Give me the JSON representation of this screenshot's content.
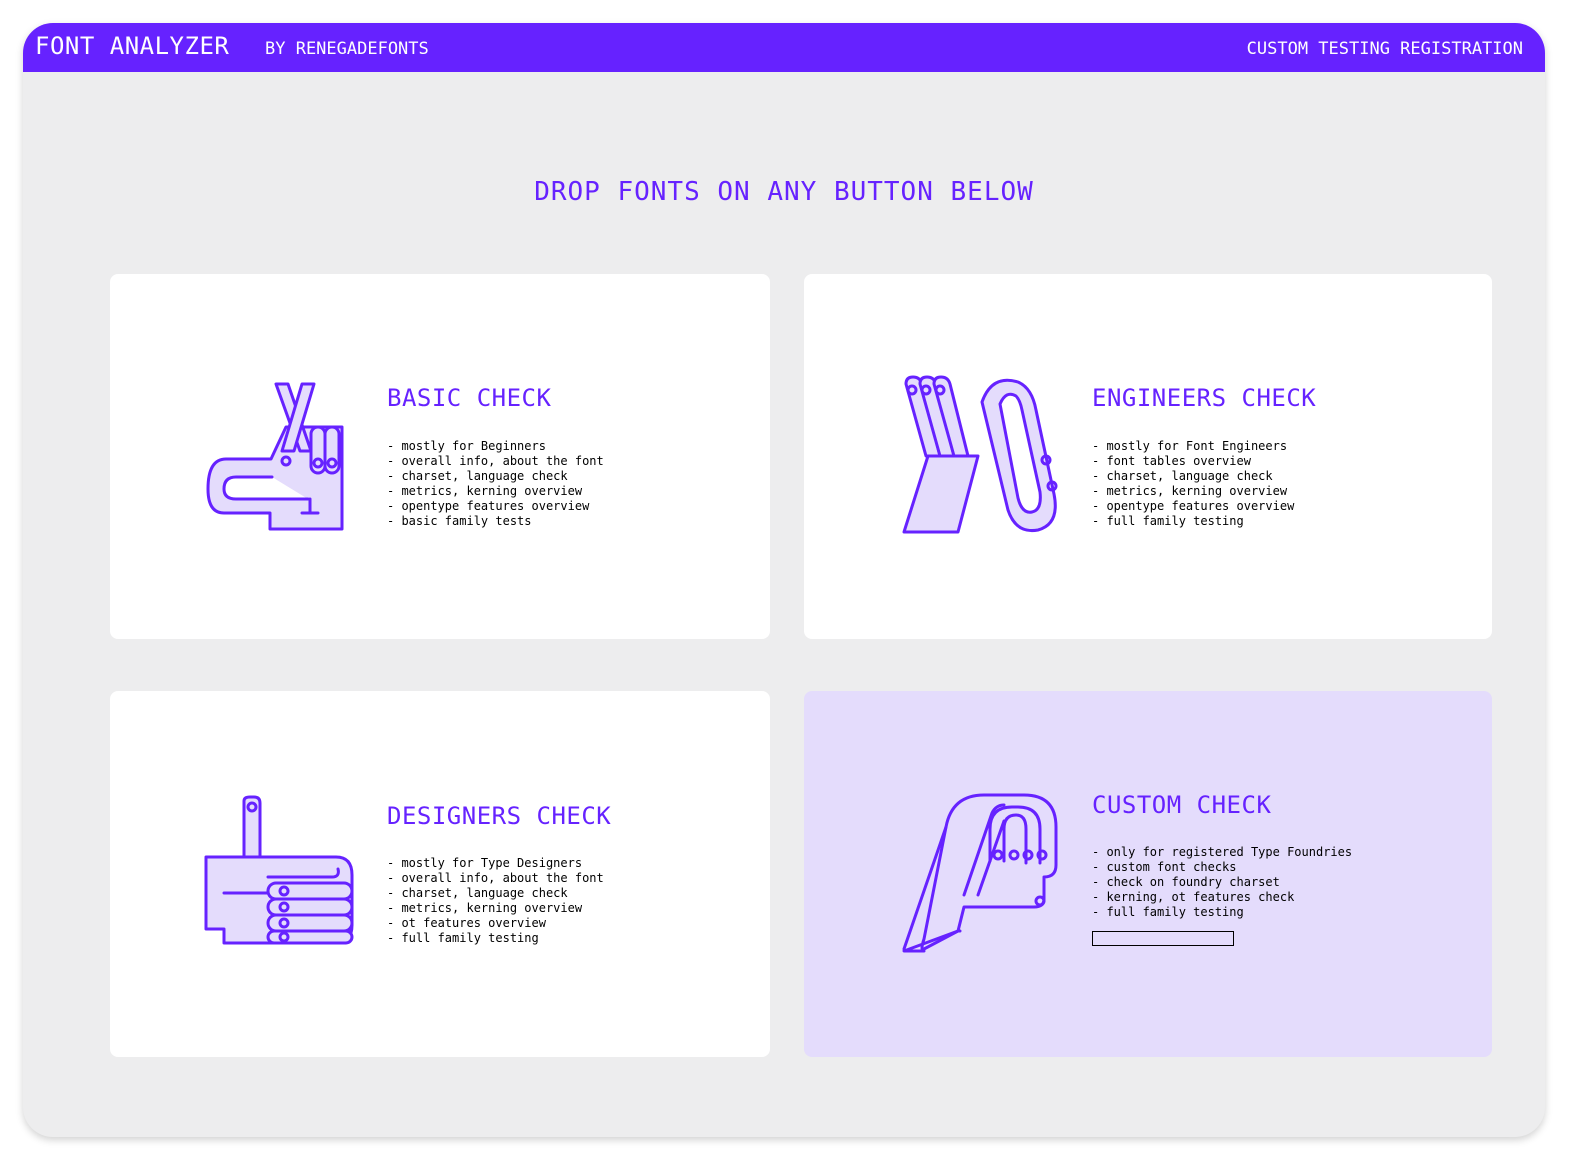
{
  "header": {
    "title": "FONT ANALYZER",
    "byline": "BY RENEGADEFONTS",
    "nav_link": "CUSTOM TESTING REGISTRATION"
  },
  "headline": "DROP FONTS ON ANY BUTTON BELOW",
  "colors": {
    "accent": "#6622ff",
    "icon_fill": "#e4dcfc",
    "background": "#ededee",
    "card": "#ffffff"
  },
  "cards": [
    {
      "title": "BASIC CHECK",
      "icon": "crossed-fingers-hand-icon",
      "features": [
        "mostly for Beginners",
        "overall info, about the font",
        "charset, language check",
        "metrics, kerning overview",
        "opentype features overview",
        "basic family tests"
      ]
    },
    {
      "title": "ENGINEERS CHECK",
      "icon": "ok-sign-hand-icon",
      "features": [
        "mostly for Font Engineers",
        "font tables overview",
        "charset, language check",
        "metrics, kerning overview",
        "opentype features overview",
        "full family testing"
      ]
    },
    {
      "title": "DESIGNERS CHECK",
      "icon": "thumbs-up-hand-icon",
      "features": [
        "mostly for Type Designers",
        "overall info, about the font",
        "charset, language check",
        "metrics, kerning overview",
        "ot features overview",
        "full family testing"
      ]
    },
    {
      "title": "CUSTOM CHECK",
      "icon": "fist-hand-icon",
      "features": [
        "only for registered Type Foundries",
        "custom font checks",
        "check on foundry charset",
        "kerning, ot features check",
        "full family testing"
      ],
      "registration_field_value": ""
    }
  ]
}
